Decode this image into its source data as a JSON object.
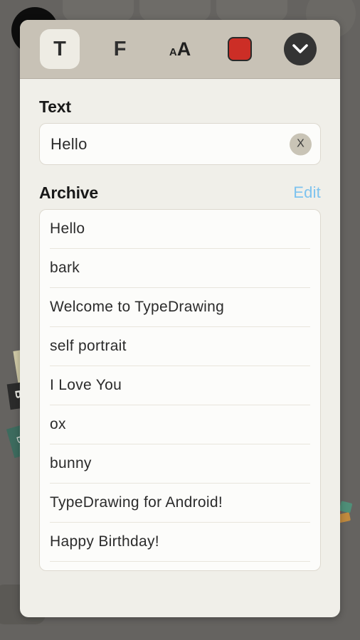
{
  "backdrop": {
    "label": "dimmed-canvas"
  },
  "toolbar": {
    "items": [
      {
        "name": "text-tool",
        "glyph": "T",
        "selected": true
      },
      {
        "name": "font-tool",
        "glyph": "F",
        "selected": false
      },
      {
        "name": "font-size-tool",
        "glyph_small": "A",
        "glyph_big": "A",
        "selected": false
      },
      {
        "name": "color-tool",
        "color": "#cc2e26",
        "selected": false
      },
      {
        "name": "collapse-tool",
        "glyph": "chevron-down",
        "selected": false
      }
    ],
    "toolbar_bg": "#c8c2b6",
    "selected_bg": "#eeece4"
  },
  "text_section": {
    "title": "Text",
    "value": "Hello",
    "placeholder": "Hello",
    "clear_label": "X"
  },
  "archive_section": {
    "title": "Archive",
    "edit_label": "Edit",
    "edit_color": "#7ec3ef",
    "items": [
      "Hello",
      "bark",
      "Welcome to TypeDrawing",
      "self portrait",
      "I Love You",
      "ox",
      "bunny",
      "TypeDrawing for Android!",
      "Happy Birthday!"
    ]
  }
}
